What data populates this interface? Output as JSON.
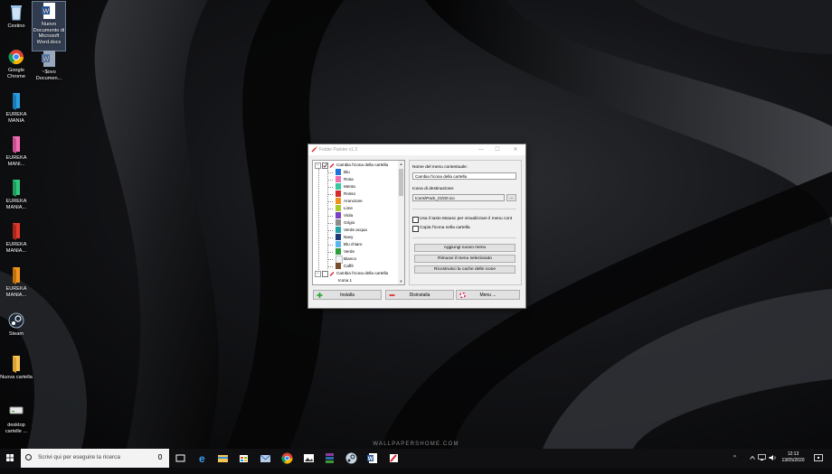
{
  "desktop": {
    "icons": [
      {
        "label": "Cestino",
        "icon": "recycle-bin-icon"
      },
      {
        "label": "Nuovo Documento di Microsoft Word.docx",
        "icon": "word-document-icon"
      },
      {
        "label": "Google Chrome",
        "icon": "chrome-icon"
      },
      {
        "label": "~$ovo Documen...",
        "icon": "word-temp-file-icon"
      },
      {
        "label": "EUREKA MANIA",
        "icon": "blue-folder-icon",
        "color": "#2d9ee0"
      },
      {
        "label": "EUREKA MANI...",
        "icon": "pink-folder-icon",
        "color": "#f26fb4"
      },
      {
        "label": "EUREKA MANIA...",
        "icon": "green-folder-icon",
        "color": "#2fc77a"
      },
      {
        "label": "EUREKA MANIA...",
        "icon": "red-folder-icon",
        "color": "#e03a2c"
      },
      {
        "label": "EUREKA MANIA...",
        "icon": "orange-folder-icon",
        "color": "#f2951d"
      },
      {
        "label": "Steam",
        "icon": "steam-icon"
      },
      {
        "label": "Nuova cartella",
        "icon": "yellow-folder-icon"
      },
      {
        "label": "desktop cartelle ...",
        "icon": "drive-icon"
      }
    ],
    "wallpaper_credit": "WALLPAPERSHOME.COM"
  },
  "window": {
    "title": "Folder Painter v1.2",
    "minimize": "—",
    "maximize": "☐",
    "close": "✕",
    "tree": {
      "root_label": "Cambia l'icona della cartella",
      "items": [
        {
          "label": "Blu",
          "color": "#1e73d8"
        },
        {
          "label": "Rosa",
          "color": "#f06fb0"
        },
        {
          "label": "Menta",
          "color": "#35c9a0"
        },
        {
          "label": "Rosso",
          "color": "#d8262b"
        },
        {
          "label": "Arancione",
          "color": "#f2901c"
        },
        {
          "label": "Lime",
          "color": "#a9c82a"
        },
        {
          "label": "Viola",
          "color": "#7a3fc2"
        },
        {
          "label": "Grigio",
          "color": "#8c8c8c"
        },
        {
          "label": "Verde acqua",
          "color": "#21a3a8"
        },
        {
          "label": "Navy",
          "color": "#1c3a7a"
        },
        {
          "label": "Blu chiaro",
          "color": "#57b8ee"
        },
        {
          "label": "Verde",
          "color": "#2f9e3a"
        },
        {
          "label": "Bianco",
          "color": "#f4f4f4"
        },
        {
          "label": "Caffè",
          "color": "#7a4e2a"
        }
      ],
      "second_root_label": "Cambia l'icona della cartella",
      "partial_label": "Icona 1"
    },
    "panel": {
      "menu_name_label": "Nome del menu contestuale:",
      "menu_name_value": "Cambia l'icona della cartella",
      "dest_icon_label": "Icona di destinazione:",
      "dest_icon_value": "Icons\\Pack_01\\00.ico",
      "browse_label": "...",
      "option1": "Usa il tasto Maiusc per visualizzare il menu cont",
      "option2": "Copia l'icona nella cartella",
      "add_menu": "Aggiungi nuovo menu",
      "remove_menu": "Rimuovi il menu selezionato",
      "rebuild_cache": "Ricostruisci la cache delle icone"
    },
    "buttons": {
      "install": "Installa",
      "uninstall": "Disinstalla",
      "menu": "Menu ..."
    }
  },
  "taskbar": {
    "search_placeholder": "Scrivi qui per eseguire la ricerca",
    "apps": [
      "task-view-icon",
      "edge-icon",
      "file-explorer-icon",
      "store-icon",
      "mail-icon",
      "chrome-icon",
      "photos-icon",
      "winrar-icon",
      "steam-icon",
      "word-icon",
      "folder-painter-icon"
    ],
    "tray_text": "ꟸ",
    "time": "12:13",
    "date": "13/05/2020"
  }
}
